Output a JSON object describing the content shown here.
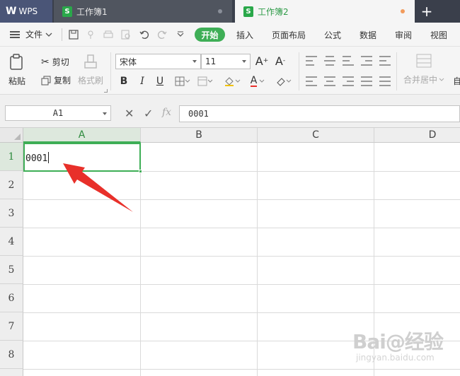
{
  "app": {
    "name": "WPS",
    "tabs": [
      {
        "label": "工作簿1",
        "active": false
      },
      {
        "label": "工作簿2",
        "active": true
      }
    ],
    "new_tab": "+"
  },
  "menu": {
    "file_label": "文件",
    "items": [
      "开始",
      "插入",
      "页面布局",
      "公式",
      "数据",
      "审阅",
      "视图"
    ],
    "active_item": "开始"
  },
  "ribbon": {
    "paste_label": "粘贴",
    "cut_label": "剪切",
    "copy_label": "复制",
    "format_painter_label": "格式刷",
    "font_name": "宋体",
    "font_size": "11",
    "bold": "B",
    "italic": "I",
    "underline": "U",
    "font_color_glyph": "A",
    "increase_font": "A",
    "decrease_font": "A",
    "merge_center_label": "合并居中",
    "auto_label": "自"
  },
  "formula_bar": {
    "cell_ref": "A1",
    "fx": "fx",
    "value": "0001"
  },
  "grid": {
    "columns": [
      "A",
      "B",
      "C",
      "D"
    ],
    "rows": [
      "1",
      "2",
      "3",
      "4",
      "5",
      "6",
      "7",
      "8"
    ],
    "active_cell": "A1",
    "cell_value": "0001"
  },
  "watermark": {
    "main": "Bai@经验",
    "sub": "jingyan.baidu.com"
  },
  "colors": {
    "accent_green": "#3eae56",
    "annotation_red": "#e8302a",
    "title_bar": "#3a3f4b"
  }
}
